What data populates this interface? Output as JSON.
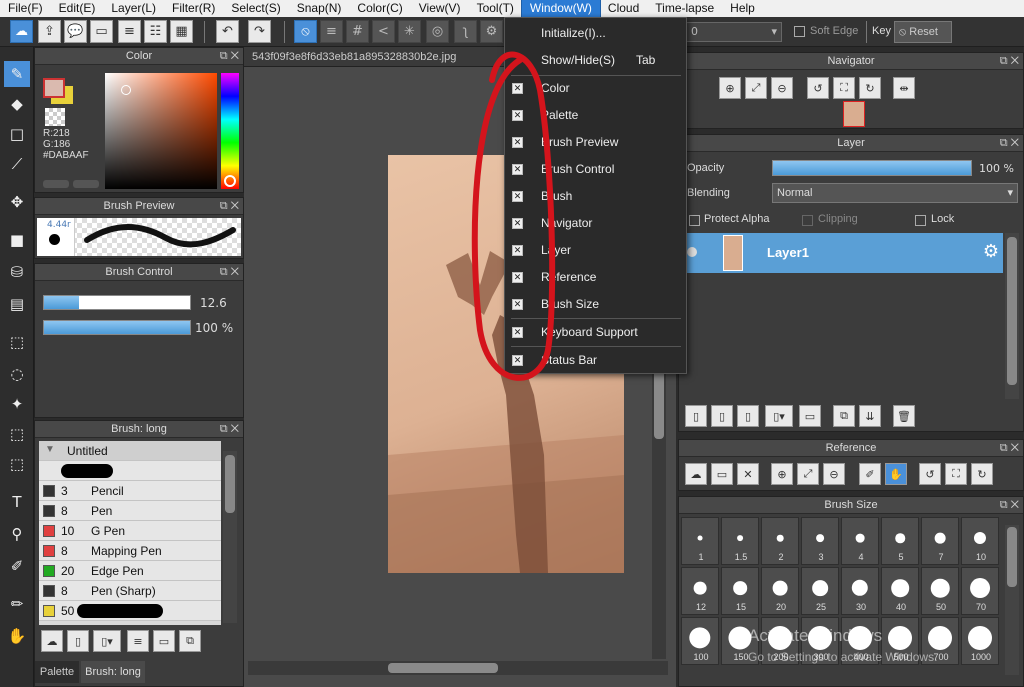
{
  "menubar": {
    "items": [
      "File(F)",
      "Edit(E)",
      "Layer(L)",
      "Filter(R)",
      "Select(S)",
      "Snap(N)",
      "Color(C)",
      "View(V)",
      "Tool(T)",
      "Window(W)",
      "Cloud",
      "Time-lapse",
      "Help"
    ],
    "active": "Window(W)"
  },
  "toolbar": {
    "brush_size_value": "0",
    "soft_edge_label": "Soft Edge",
    "key_label": "Key",
    "reset_label": "Reset"
  },
  "color_panel": {
    "title": "Color",
    "r_label": "R:218",
    "g_label": "G:186",
    "hex_label": "#DABAAF",
    "primary_color": "#DABAAF",
    "secondary_color": "#E8D13A"
  },
  "brush_preview": {
    "title": "Brush Preview",
    "size_text": "4.44r"
  },
  "brush_control": {
    "title": "Brush Control",
    "size_value": "12.6",
    "opacity_value": "100 %"
  },
  "brush_list": {
    "title": "Brush: long",
    "group": "Untitled",
    "rows": [
      {
        "size": "3",
        "name": "Pencil",
        "color": "#333333"
      },
      {
        "size": "8",
        "name": "Pen",
        "color": "#333333"
      },
      {
        "size": "10",
        "name": "G Pen",
        "color": "#e04040"
      },
      {
        "size": "8",
        "name": "Mapping Pen",
        "color": "#e04040"
      },
      {
        "size": "20",
        "name": "Edge Pen",
        "color": "#22aa22"
      },
      {
        "size": "8",
        "name": "Pen (Sharp)",
        "color": "#333333"
      },
      {
        "size": "50",
        "name": "",
        "color": "#e8d13a"
      }
    ],
    "bottom_tabs": [
      "Palette",
      "Brush: long"
    ]
  },
  "document": {
    "tab_title": "543f09f3e8f6d33eb81a895328830b2e.jpg"
  },
  "window_menu": {
    "items": [
      {
        "label": "Initialize(I)...",
        "checked": false,
        "shortcut": ""
      },
      {
        "label": "Show/Hide(S)",
        "checked": false,
        "shortcut": "Tab"
      },
      {
        "label": "Color",
        "checked": true,
        "shortcut": ""
      },
      {
        "label": "Palette",
        "checked": true,
        "shortcut": ""
      },
      {
        "label": "Brush Preview",
        "checked": true,
        "shortcut": ""
      },
      {
        "label": "Brush Control",
        "checked": true,
        "shortcut": ""
      },
      {
        "label": "Brush",
        "checked": true,
        "shortcut": ""
      },
      {
        "label": "Navigator",
        "checked": true,
        "shortcut": ""
      },
      {
        "label": "Layer",
        "checked": true,
        "shortcut": ""
      },
      {
        "label": "Reference",
        "checked": true,
        "shortcut": ""
      },
      {
        "label": "Brush Size",
        "checked": true,
        "shortcut": ""
      },
      {
        "label": "Keyboard Support",
        "checked": true,
        "shortcut": ""
      },
      {
        "label": "Status Bar",
        "checked": true,
        "shortcut": ""
      }
    ]
  },
  "navigator": {
    "title": "Navigator"
  },
  "layer_panel": {
    "title": "Layer",
    "opacity_label": "Opacity",
    "opacity_value": "100 %",
    "opacity_fraction": 1.0,
    "blending_label": "Blending",
    "blending_value": "Normal",
    "protect_alpha_label": "Protect Alpha",
    "clipping_label": "Clipping",
    "lock_label": "Lock",
    "layer_name": "Layer1"
  },
  "reference": {
    "title": "Reference"
  },
  "brush_size_panel": {
    "title": "Brush Size",
    "sizes": [
      "1",
      "1.5",
      "2",
      "3",
      "4",
      "5",
      "7",
      "10",
      "12",
      "15",
      "20",
      "25",
      "30",
      "40",
      "50",
      "70",
      "100",
      "150",
      "200",
      "300",
      "400",
      "500",
      "700",
      "1000"
    ]
  },
  "watermark": {
    "line1": "Activate Windows",
    "line2": "Go to Settings to activate Windows."
  }
}
